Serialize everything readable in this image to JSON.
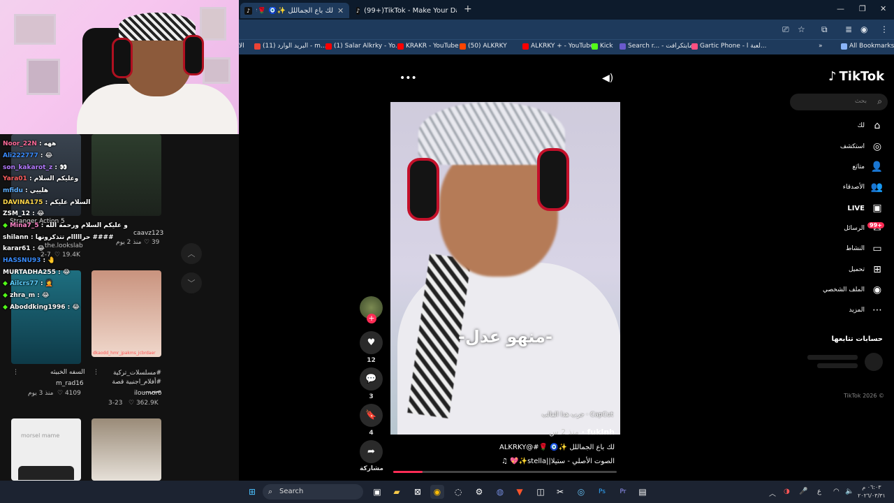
{
  "browser": {
    "tabs": [
      {
        "label": "لك باع الجماللل ✨🧿 🌹#@ ",
        "active": true
      },
      {
        "label": "(99+)TikTok - Make Your Day",
        "active": false
      }
    ],
    "bookmarks": [
      {
        "label": "(11) البريد الوارد - m...",
        "color": "#ea4335"
      },
      {
        "label": "(1) Salar Alkrky - Yo...",
        "color": "#ff0000"
      },
      {
        "label": "KRAKR - YouTube",
        "color": "#ff0000"
      },
      {
        "label": "(50) ALKRKY",
        "color": "#ff4500"
      },
      {
        "label": "ALKRKY + - YouTube",
        "color": "#ff0000"
      },
      {
        "label": "Kick",
        "color": "#53fc18"
      },
      {
        "label": "Search r... - مايتكرافت",
        "color": "#6a5acd"
      },
      {
        "label": "Gartic Phone - لعبة ا...",
        "color": "#ff4f81"
      },
      {
        "label": "All Bookmarks",
        "color": "#8ab4f8"
      }
    ],
    "bookmark_left": "الا"
  },
  "chat": [
    {
      "user": "Noor_22N",
      "msg": "ههه",
      "color": "#ff6b9a"
    },
    {
      "user": "Ali222777",
      "msg": "😂",
      "color": "#3a8dff"
    },
    {
      "user": "son_kakarot_z",
      "msg": "👀",
      "color": "#b57bff"
    },
    {
      "user": "Yara01",
      "msg": "وعليكم السلام",
      "color": "#ff5f5f"
    },
    {
      "user": "mfidu",
      "msg": "هلييي",
      "color": "#5fb0ff"
    },
    {
      "user": "DAVINA175",
      "msg": "السلام عليكم",
      "color": "#ffd84a"
    },
    {
      "user": "ZSM_12",
      "msg": "😂",
      "color": "#ffffff"
    },
    {
      "user": "Mina7_5",
      "msg": "و عليكم السلام ورحمة الله",
      "color": "#ff85c8"
    },
    {
      "user": "shilann",
      "msg": "حرااااام تتذكرونها ####",
      "color": "#ffffff"
    },
    {
      "user": "karar61",
      "msg": "😂",
      "color": "#ffffff"
    },
    {
      "user": "HASSNU93",
      "msg": "🤚",
      "color": "#3a8dff"
    },
    {
      "user": "MURTADHA255",
      "msg": "😂",
      "color": "#ffffff"
    },
    {
      "user": "Ailcrs77",
      "msg": "🤦",
      "color": "#5fd0ff"
    },
    {
      "user": "zhra_m",
      "msg": "😂",
      "color": "#ffffff"
    },
    {
      "user": "Aboddking1996",
      "msg": "😂",
      "color": "#ffffff"
    }
  ],
  "feed": {
    "overlay_text": "Stranger Action 5",
    "items": [
      {
        "author": "caavz123",
        "time": "منذ 2 يوم",
        "likes": "39"
      },
      {
        "author": "the.lookslab",
        "time": "2-7",
        "likes": "19.4K"
      },
      {
        "caption": "السفه الخبيثه",
        "author": "m_rad16",
        "time": "منذ 3 يوم",
        "likes": "4109"
      },
      {
        "caption": "#مسلسلات_تركية #أفلام_اجنبية قصة صبي...",
        "author": "iloumoro",
        "time": "3-23",
        "likes": "362.9K"
      }
    ],
    "thumb_watermark": "dkaodd_hmr_jpakms_jcbrdaer",
    "morsel": "morsel mame"
  },
  "video": {
    "caption_overlay": "-منهو عدل-",
    "capcut": "CapCut · جرب هذا القالب",
    "author": "fuklnh",
    "time": "منذ 2 س",
    "description": "لك باع الجماللل ✨🧿 🌹#@ALKRKY",
    "sound": "الصوت الأصلي - ستيلا||stella✨💖 ♫",
    "progress": 0.13
  },
  "actions": {
    "likes": "12",
    "comments": "3",
    "saves": "4",
    "share": "مشاركة"
  },
  "sidebar": {
    "brand": "TikTok",
    "search_placeholder": "بحث",
    "nav": [
      {
        "label": "لك",
        "icon": "home-icon"
      },
      {
        "label": "استكشف",
        "icon": "compass-icon"
      },
      {
        "label": "متابَع",
        "icon": "user-follow-icon"
      },
      {
        "label": "الأصدقاء",
        "icon": "friends-icon"
      },
      {
        "label": "LIVE",
        "icon": "live-icon"
      },
      {
        "label": "الرسائل",
        "icon": "messages-icon"
      },
      {
        "label": "النشاط",
        "icon": "activity-icon"
      },
      {
        "label": "تحميل",
        "icon": "upload-icon"
      },
      {
        "label": "الملف الشخصي",
        "icon": "profile-icon"
      },
      {
        "label": "المزيد",
        "icon": "more-icon"
      }
    ],
    "messages_badge": "99+",
    "following_title": "حسابات تتابعها",
    "copyright": "TikTok 2026 ©"
  },
  "taskbar": {
    "search_label": "Search",
    "lang": "ع",
    "time": "٠٦:٠٣ م",
    "date": "٢٠٢٦/٠٣/٣١"
  }
}
